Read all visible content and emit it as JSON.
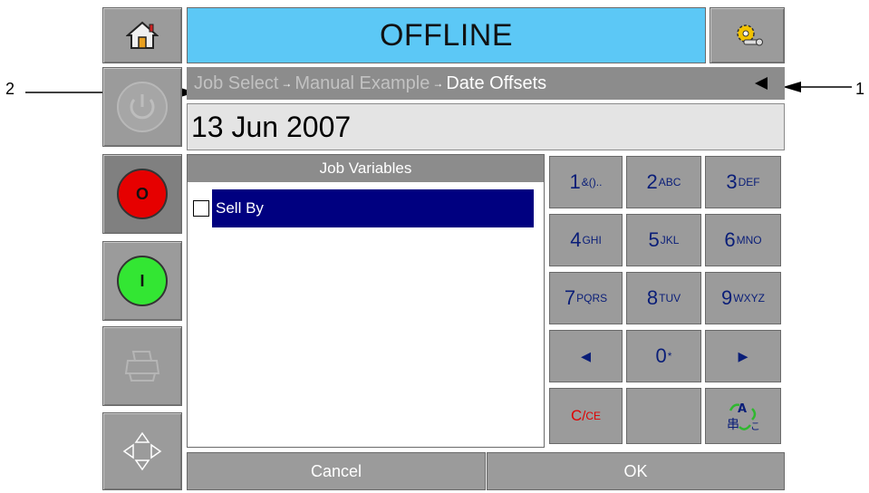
{
  "header": {
    "status_title": "OFFLINE"
  },
  "breadcrumb": {
    "item1": "Job Select",
    "item2": "Manual Example",
    "item3": "Date Offsets",
    "back_icon": "left-triangle-icon"
  },
  "date_field": {
    "value": "13 Jun 2007"
  },
  "job_variables": {
    "title": "Job Variables",
    "items": [
      {
        "label": "Sell By",
        "checked": false,
        "selected": true
      }
    ]
  },
  "keypad": {
    "keys": [
      {
        "main": "1",
        "sub": "&()..",
        "name": "key-1"
      },
      {
        "main": "2",
        "sub": "ABC",
        "name": "key-2"
      },
      {
        "main": "3",
        "sub": "DEF",
        "name": "key-3"
      },
      {
        "main": "4",
        "sub": "GHI",
        "name": "key-4"
      },
      {
        "main": "5",
        "sub": "JKL",
        "name": "key-5"
      },
      {
        "main": "6",
        "sub": "MNO",
        "name": "key-6"
      },
      {
        "main": "7",
        "sub": "PQRS",
        "name": "key-7"
      },
      {
        "main": "8",
        "sub": "TUV",
        "name": "key-8"
      },
      {
        "main": "9",
        "sub": "WXYZ",
        "name": "key-9"
      },
      {
        "main": "◂",
        "sub": "",
        "name": "key-left-arrow"
      },
      {
        "main": "0",
        "sub": "*",
        "name": "key-0"
      },
      {
        "main": "▸",
        "sub": "",
        "name": "key-right-arrow"
      }
    ],
    "clear_label": "C",
    "clear_sub": "CE"
  },
  "buttons": {
    "cancel": "Cancel",
    "ok": "OK",
    "stop_label": "O",
    "start_label": "I"
  },
  "callouts": {
    "one": "1",
    "two": "2"
  },
  "colors": {
    "title_bg": "#5cc8f6",
    "selection": "#000080",
    "stop": "#e60000",
    "start": "#33e633",
    "key_text": "#0a1e78",
    "clear_text": "#e00000"
  }
}
